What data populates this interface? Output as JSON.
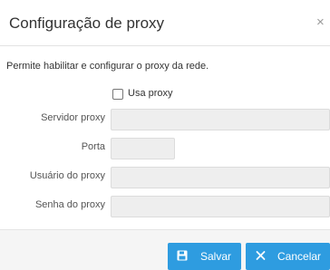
{
  "dialog": {
    "title": "Configuração de proxy",
    "close_label": "×",
    "description": "Permite habilitar e configurar o proxy da rede."
  },
  "form": {
    "use_proxy_label": "Usa proxy",
    "use_proxy_checked": false,
    "server_label": "Servidor proxy",
    "server_value": "",
    "port_label": "Porta",
    "port_value": "",
    "user_label": "Usuário do proxy",
    "user_value": "",
    "password_label": "Senha do proxy",
    "password_value": ""
  },
  "footer": {
    "save_label": "Salvar",
    "cancel_label": "Cancelar"
  },
  "colors": {
    "button": "#2e9ce0",
    "input_disabled": "#eeeeee",
    "footer_bg": "#f5f5f5"
  },
  "icons": {
    "save": "floppy-disk-icon",
    "cancel": "close-icon",
    "dialog_close": "close-icon"
  }
}
